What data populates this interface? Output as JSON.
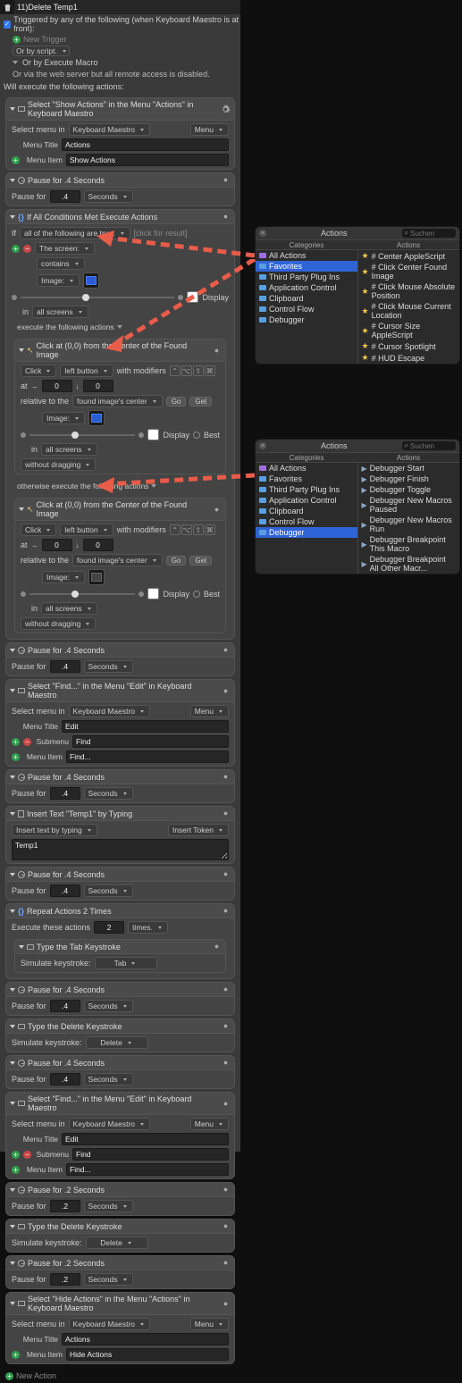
{
  "title_field": "11)Delete Temp1",
  "trigger_label": "Triggered by any of the following (when Keyboard Maestro is at front):",
  "new_trigger": "New Trigger",
  "or_script": "Or by script.",
  "or_execute": "Or by Execute Macro",
  "or_web": "Or via the web server but all remote access is disabled.",
  "will_execute": "Will execute the following actions:",
  "menu_label": "Menu",
  "seconds": "Seconds",
  "pause_for": "Pause for",
  "pause_val_a": ".4",
  "pause_val_b": ".2",
  "select_menu_in": "Select menu in",
  "km_app": "Keyboard Maestro",
  "menu_title_lbl": "Menu Title",
  "submenu_lbl": "Submenu",
  "menu_item_lbl": "Menu Item",
  "actions": {
    "show_actions": {
      "title": "Select \"Show Actions\" in the Menu \"Actions\" in Keyboard Maestro",
      "menu_title": "Actions",
      "menu_item": "Show Actions"
    },
    "pause4_title": "Pause for .4 Seconds",
    "if_title": "If All Conditions Met Execute Actions",
    "if_line": "all of the following are true:",
    "if_hint": "[click for result]",
    "the_screen": "The screen:",
    "contains": "contains",
    "image_lbl": "Image:",
    "display_lbl": "Display",
    "best_lbl": "Best",
    "in_screens": "in",
    "all_screens": "all screens",
    "exec_following": "execute the following actions",
    "otherwise": "otherwise execute the following actions",
    "click_title": "Click at (0,0) from the Center of the Found Image",
    "click_lbl": "Click",
    "left_button": "left button",
    "with_mods": "with modifiers",
    "at_lbl": "at",
    "coord_x": "0",
    "coord_y": "0",
    "relative_to": "relative to the",
    "found_center": "found image's center",
    "go": "Go",
    "get": "Get",
    "without_drag": "without dragging",
    "find_title": "Select \"Find...\" in the Menu \"Edit\" in Keyboard Maestro",
    "find_menu_title": "Edit",
    "find_submenu": "Find",
    "find_item": "Find...",
    "insert_title": "Insert Text \"Temp1\" by Typing",
    "insert_sub": "Insert text by typing",
    "insert_token": "Insert Token",
    "insert_text": "Temp1",
    "repeat_title": "Repeat Actions 2 Times",
    "repeat_line": "Execute these actions",
    "repeat_n": "2",
    "repeat_times": "times.",
    "tab_title": "Type the Tab Keystroke",
    "del_title": "Type the Delete Keystroke",
    "sim_key": "Simulate keystroke:",
    "tab_key": "Tab",
    "del_key": "Delete",
    "hide_title": "Select \"Hide Actions\" in the Menu \"Actions\" in Keyboard Maestro",
    "hide_menu_title": "Actions",
    "hide_menu_item": "Hide Actions",
    "pause2_title": "Pause for .2 Seconds"
  },
  "new_action": "New Action",
  "panel1": {
    "title": "Actions",
    "search": "Suchen",
    "col_cat": "Categories",
    "col_act": "Actions",
    "cats": [
      "All Actions",
      "Favorites",
      "Third Party Plug Ins",
      "Application Control",
      "Clipboard",
      "Control Flow",
      "Debugger"
    ],
    "sel_cat_idx": 1,
    "acts": [
      "# Center AppleScript",
      "# Click Center Found Image",
      "# Click Mouse Absolute Position",
      "# Click Mouse Current Location",
      "# Cursor Size AppleScript",
      "# Cursor Spotlight",
      "# HUD Escape"
    ]
  },
  "panel2": {
    "title": "Actions",
    "search": "Suchen",
    "col_cat": "Categories",
    "col_act": "Actions",
    "cats": [
      "All Actions",
      "Favorites",
      "Third Party Plug Ins",
      "Application Control",
      "Clipboard",
      "Control Flow",
      "Debugger"
    ],
    "sel_cat_idx": 6,
    "acts": [
      "Debugger Start",
      "Debugger Finish",
      "Debugger Toggle",
      "Debugger New Macros Paused",
      "Debugger New Macros Run",
      "Debugger Breakpoint This Macro",
      "Debugger Breakpoint All Other Macr..."
    ]
  }
}
